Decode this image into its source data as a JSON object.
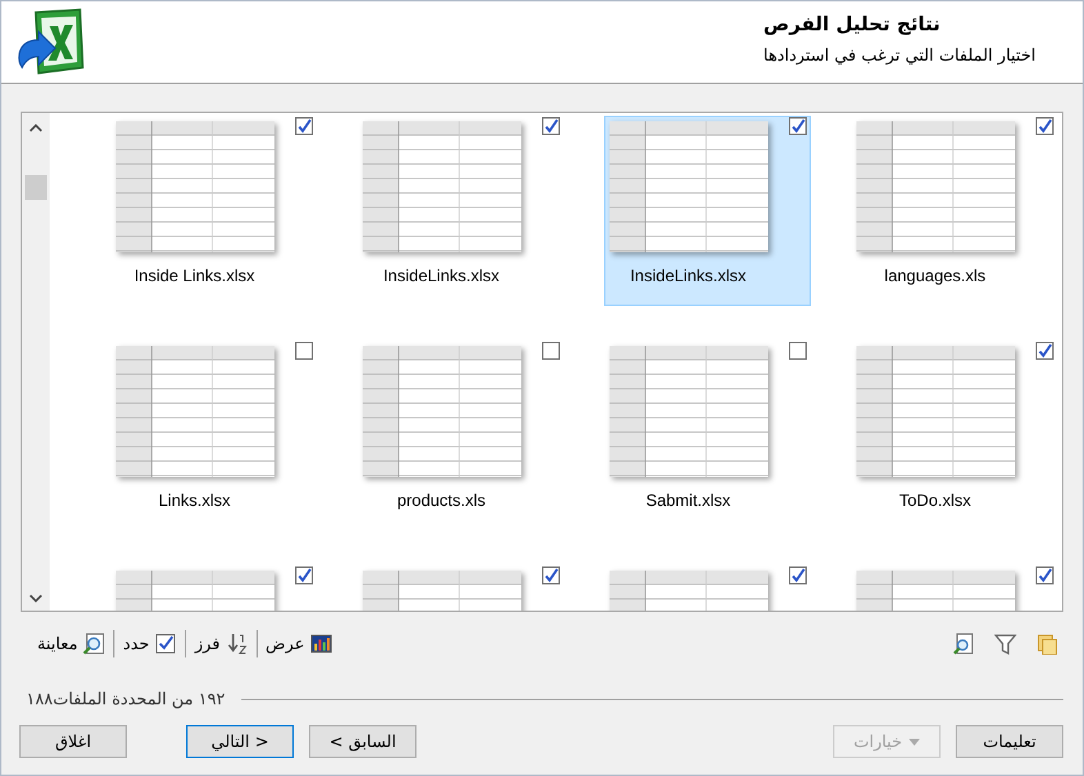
{
  "header": {
    "title": "نتائج تحليل الفرص",
    "subtitle": "اختيار الملفات التي ترغب في استردادها"
  },
  "file_rows": [
    {
      "files": [
        {
          "name": "languages.xls",
          "checked": true,
          "selected": false
        },
        {
          "name": "InsideLinks.xlsx",
          "checked": true,
          "selected": true
        },
        {
          "name": "InsideLinks.xlsx",
          "checked": true,
          "selected": false
        },
        {
          "name": "Inside Links.xlsx",
          "checked": true,
          "selected": false
        }
      ]
    },
    {
      "files": [
        {
          "name": "ToDo.xlsx",
          "checked": true,
          "selected": false
        },
        {
          "name": "Sabmit.xlsx",
          "checked": false,
          "selected": false
        },
        {
          "name": "products.xls",
          "checked": false,
          "selected": false
        },
        {
          "name": "Links.xlsx",
          "checked": false,
          "selected": false
        }
      ]
    },
    {
      "files": [
        {
          "checked": true,
          "selected": false
        },
        {
          "checked": true,
          "selected": false
        },
        {
          "checked": true,
          "selected": false
        },
        {
          "checked": true,
          "selected": false
        }
      ]
    }
  ],
  "toolbar": {
    "icon_tools": [
      {
        "kind": "copy"
      },
      {
        "kind": "filter"
      },
      {
        "kind": "find"
      }
    ],
    "view_tools": [
      {
        "kind": "chart",
        "label": "عرض"
      },
      {
        "kind": "sort",
        "label": "فرز"
      },
      {
        "kind": "check",
        "label": "حدد"
      },
      {
        "kind": "preview",
        "label": "معاينة"
      }
    ]
  },
  "status_bar": {
    "text": "١٩٢ من المحددة الملفات١٨٨"
  },
  "buttons": {
    "side": [
      {
        "label": "تعليمات",
        "disabled": false,
        "dropdown": false
      },
      {
        "label": "خيارات",
        "disabled": true,
        "dropdown": true
      }
    ],
    "nav": [
      {
        "label": "< السابق",
        "focused": false
      },
      {
        "label": "التالي >",
        "focused": true
      },
      {
        "label": "اغلاق",
        "focused": false
      }
    ]
  }
}
